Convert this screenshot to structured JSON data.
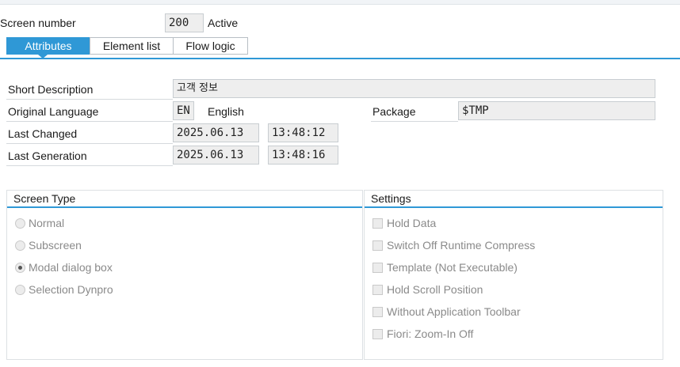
{
  "header": {
    "screen_number_label": "Screen number",
    "screen_number_value": "200",
    "status": "Active"
  },
  "tabs": [
    {
      "label": "Attributes",
      "active": true
    },
    {
      "label": "Element list",
      "active": false
    },
    {
      "label": "Flow logic",
      "active": false
    }
  ],
  "attributes": {
    "short_description": {
      "label": "Short Description",
      "value": "고객 정보"
    },
    "original_language": {
      "label": "Original Language",
      "code": "EN",
      "name": "English"
    },
    "package": {
      "label": "Package",
      "value": "$TMP"
    },
    "last_changed": {
      "label": "Last Changed",
      "date": "2025.06.13",
      "time": "13:48:12"
    },
    "last_generation": {
      "label": "Last Generation",
      "date": "2025.06.13",
      "time": "13:48:16"
    }
  },
  "screen_type": {
    "title": "Screen Type",
    "options": [
      {
        "label": "Normal",
        "checked": false
      },
      {
        "label": "Subscreen",
        "checked": false
      },
      {
        "label": "Modal dialog box",
        "checked": true
      },
      {
        "label": "Selection Dynpro",
        "checked": false
      }
    ]
  },
  "settings": {
    "title": "Settings",
    "options": [
      {
        "label": "Hold Data",
        "checked": false
      },
      {
        "label": "Switch Off Runtime Compress",
        "checked": false
      },
      {
        "label": "Template (Not Executable)",
        "checked": false
      },
      {
        "label": "Hold Scroll Position",
        "checked": false
      },
      {
        "label": "Without Application Toolbar",
        "checked": false
      },
      {
        "label": "Fiori: Zoom-In Off",
        "checked": false
      }
    ]
  },
  "colors": {
    "accent": "#2f98d6",
    "field_bg": "#eeeeee",
    "disabled_text": "#8a8a8a"
  }
}
